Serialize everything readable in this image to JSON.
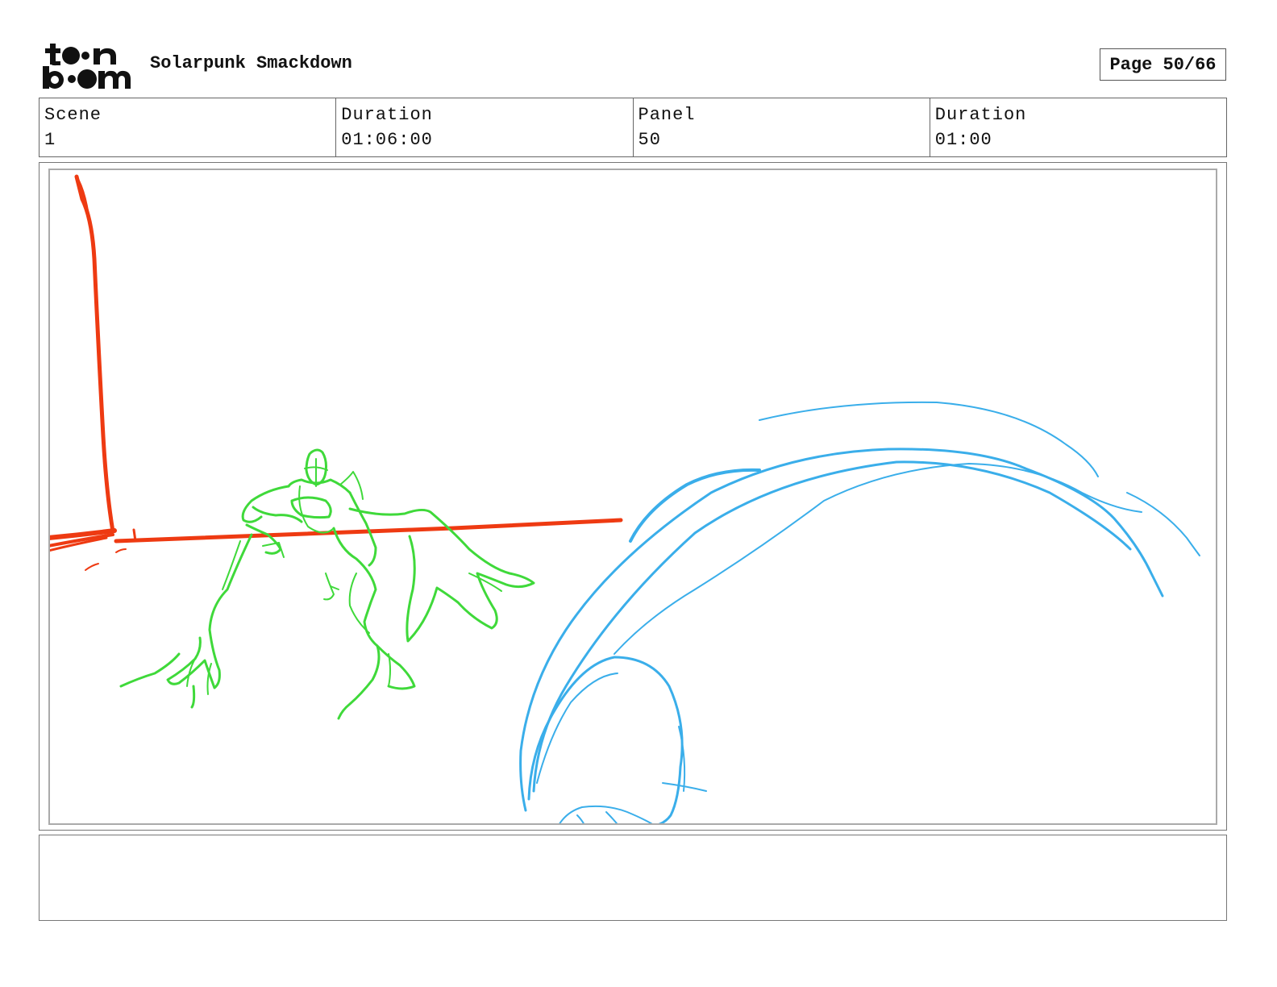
{
  "header": {
    "brand": "toon boom",
    "project_title": "Solarpunk Smackdown",
    "page_label": "Page 50/66"
  },
  "info": [
    {
      "label": "Scene",
      "value": "1"
    },
    {
      "label": "Duration",
      "value": "01:06:00"
    },
    {
      "label": "Panel",
      "value": "50"
    },
    {
      "label": "Duration",
      "value": "01:00"
    }
  ],
  "colors": {
    "red_stroke": "#ee3a12",
    "green_stroke": "#3fd93a",
    "blue_stroke": "#3aaeea",
    "border": "#777777"
  },
  "caption": {
    "text": ""
  }
}
